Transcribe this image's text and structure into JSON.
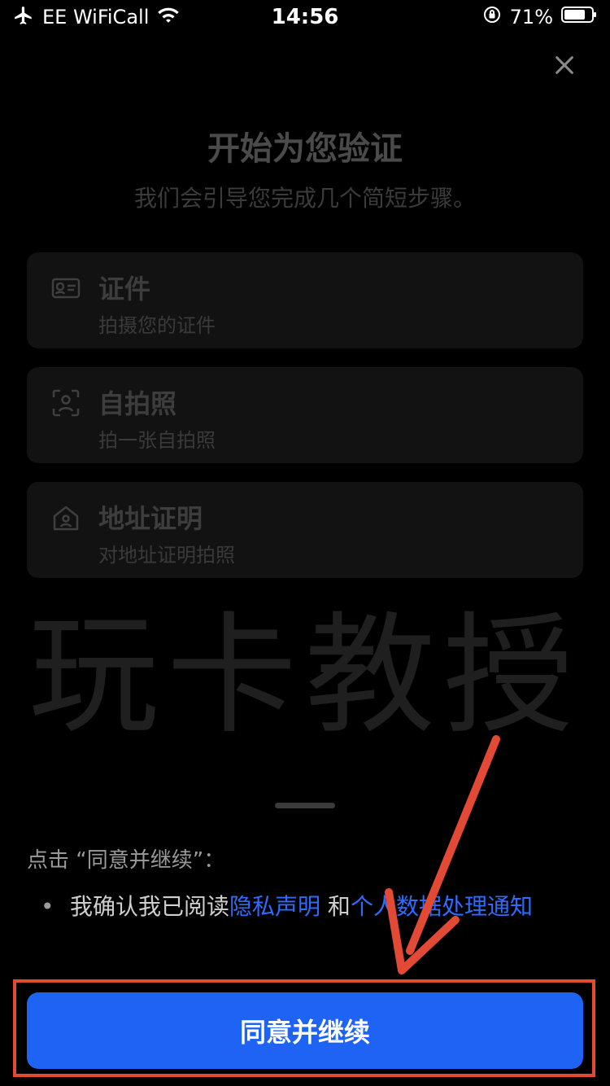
{
  "status_bar": {
    "carrier": "EE WiFiCall",
    "time": "14:56",
    "battery": "71%"
  },
  "header": {
    "title": "开始为您验证",
    "subtitle": "我们会引导您完成几个简短步骤。"
  },
  "steps": [
    {
      "title": "证件",
      "subtitle": "拍摄您的证件",
      "icon": "id-card-icon"
    },
    {
      "title": "自拍照",
      "subtitle": "拍一张自拍照",
      "icon": "selfie-icon"
    },
    {
      "title": "地址证明",
      "subtitle": "对地址证明拍照",
      "icon": "home-icon"
    }
  ],
  "watermark": "玩卡教授",
  "consent": {
    "intro": "点击 “同意并继续”：",
    "bullet": "•",
    "text_before": "我确认我已阅读",
    "privacy_link": "隐私声明",
    "and": " 和",
    "data_notice_link": "个人数据处理通知"
  },
  "primary_button": "同意并继续",
  "colors": {
    "accent": "#1f63f4",
    "link": "#2f6bff",
    "annotation": "#e34a35"
  }
}
